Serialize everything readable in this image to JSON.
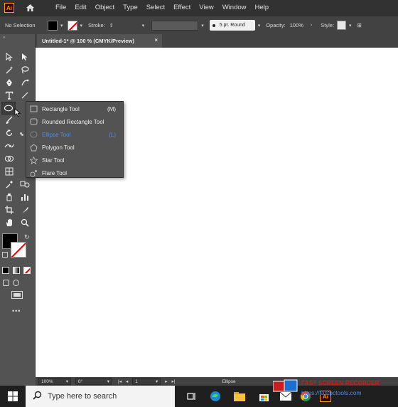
{
  "app": {
    "logo_text": "Ai",
    "menu": [
      "File",
      "Edit",
      "Object",
      "Type",
      "Select",
      "Effect",
      "View",
      "Window",
      "Help"
    ]
  },
  "control_bar": {
    "selection_label": "No Selection",
    "stroke_label": "Stroke:",
    "stroke_style": "5 pt. Round",
    "opacity_label": "Opacity:",
    "opacity_value": "100%",
    "style_label": "Style:"
  },
  "document": {
    "tab_title": "Untitled-1* @ 100 % (CMYK/Preview)",
    "close_glyph": "×"
  },
  "flyout": {
    "items": [
      {
        "label": "Rectangle Tool",
        "shortcut": "(M)",
        "icon": "rectangle-icon",
        "active": false
      },
      {
        "label": "Rounded Rectangle Tool",
        "shortcut": "",
        "icon": "rounded-rectangle-icon",
        "active": false
      },
      {
        "label": "Ellipse Tool",
        "shortcut": "(L)",
        "icon": "ellipse-icon",
        "active": true
      },
      {
        "label": "Polygon Tool",
        "shortcut": "",
        "icon": "polygon-icon",
        "active": false
      },
      {
        "label": "Star Tool",
        "shortcut": "",
        "icon": "star-icon",
        "active": false
      },
      {
        "label": "Flare Tool",
        "shortcut": "",
        "icon": "flare-icon",
        "active": false
      }
    ]
  },
  "status_bar": {
    "zoom": "100%",
    "rotation": "0°",
    "artboard": "1",
    "current_tool": "Ellipse"
  },
  "taskbar": {
    "search_placeholder": "Type here to search"
  },
  "watermark": {
    "line1": "FAST SCREEN RECORDER",
    "line2": "https://fastpctools.com"
  },
  "colors": {
    "active_item": "#4d8ee8",
    "panel": "#535353",
    "menubar": "#323232",
    "accent_orange": "#ff9a00"
  }
}
